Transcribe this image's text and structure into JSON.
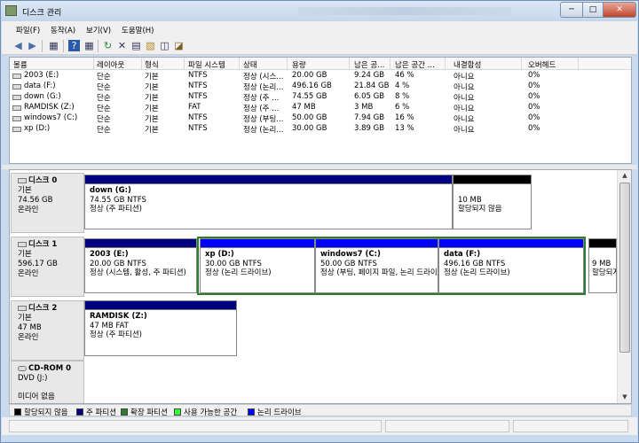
{
  "window": {
    "title": "디스크 관리",
    "min": "─",
    "max": "□",
    "close": "✕"
  },
  "menu": [
    "파일(F)",
    "동작(A)",
    "보기(V)",
    "도움말(H)"
  ],
  "toolbar": {
    "back": "◀",
    "fwd": "▶",
    "icons": [
      "▦",
      "?",
      "▦",
      "↻",
      "✕",
      "▤",
      "▧",
      "◫",
      "◪"
    ]
  },
  "columns": [
    "볼륨",
    "레이아웃",
    "형식",
    "파일 시스템",
    "상태",
    "용량",
    "남은 공...",
    "남은 공간 ...",
    "내결함성",
    "오버헤드"
  ],
  "volumes": [
    [
      "2003 (E:)",
      "단순",
      "기본",
      "NTFS",
      "정상 (시스...",
      "20.00 GB",
      "9.24 GB",
      "46 %",
      "아니요",
      "0%"
    ],
    [
      "data (F:)",
      "단순",
      "기본",
      "NTFS",
      "정상 (논리...",
      "496.16 GB",
      "21.84 GB",
      "4 %",
      "아니요",
      "0%"
    ],
    [
      "down (G:)",
      "단순",
      "기본",
      "NTFS",
      "정상 (주 ...",
      "74.55 GB",
      "6.05 GB",
      "8 %",
      "아니요",
      "0%"
    ],
    [
      "RAMDISK (Z:)",
      "단순",
      "기본",
      "FAT",
      "정상 (주 ...",
      "47 MB",
      "3 MB",
      "6 %",
      "아니요",
      "0%"
    ],
    [
      "windows7 (C:)",
      "단순",
      "기본",
      "NTFS",
      "정상 (부팅...",
      "50.00 GB",
      "7.94 GB",
      "16 %",
      "아니요",
      "0%"
    ],
    [
      "xp (D:)",
      "단순",
      "기본",
      "NTFS",
      "정상 (논리...",
      "30.00 GB",
      "3.89 GB",
      "13 %",
      "아니요",
      "0%"
    ]
  ],
  "disks": {
    "d0": {
      "name": "디스크 0",
      "type": "기본",
      "size": "74.56 GB",
      "state": "온라인"
    },
    "d1": {
      "name": "디스크 1",
      "type": "기본",
      "size": "596.17 GB",
      "state": "온라인"
    },
    "d2": {
      "name": "디스크 2",
      "type": "기본",
      "size": "47 MB",
      "state": "온라인"
    },
    "cd": {
      "name": "CD-ROM 0",
      "type": "DVD (J:)",
      "state": "미디어 없음"
    }
  },
  "parts": {
    "down": {
      "name": "down  (G:)",
      "size": "74.55 GB NTFS",
      "status": "정상 (주 파티션)"
    },
    "un0": {
      "size": "10 MB",
      "status": "할당되지 않음"
    },
    "p2003": {
      "name": "2003  (E:)",
      "size": "20.00 GB NTFS",
      "status": "정상 (시스템, 활성, 주 파티션)"
    },
    "xp": {
      "name": "xp  (D:)",
      "size": "30.00 GB NTFS",
      "status": "정상 (논리 드라이브)"
    },
    "win7": {
      "name": "windows7  (C:)",
      "size": "50.00 GB NTFS",
      "status": "정상 (부팅, 페이지 파일, 논리 드라이브)"
    },
    "data": {
      "name": "data  (F:)",
      "size": "496.16 GB NTFS",
      "status": "정상 (논리 드라이브)"
    },
    "un1": {
      "size": "9 MB",
      "status": "할당되지 않음"
    },
    "ram": {
      "name": "RAMDISK  (Z:)",
      "size": "47 MB FAT",
      "status": "정상 (주 파티션)"
    }
  },
  "legend": [
    "할당되지 않음",
    "주 파티션",
    "확장 파티션",
    "사용 가능한 공간",
    "논리 드라이브"
  ],
  "colors": {
    "unallocated": "#000000",
    "primary": "#000080",
    "extended": "#2e7d2e",
    "free": "#33ff33",
    "logical": "#0000ff"
  }
}
